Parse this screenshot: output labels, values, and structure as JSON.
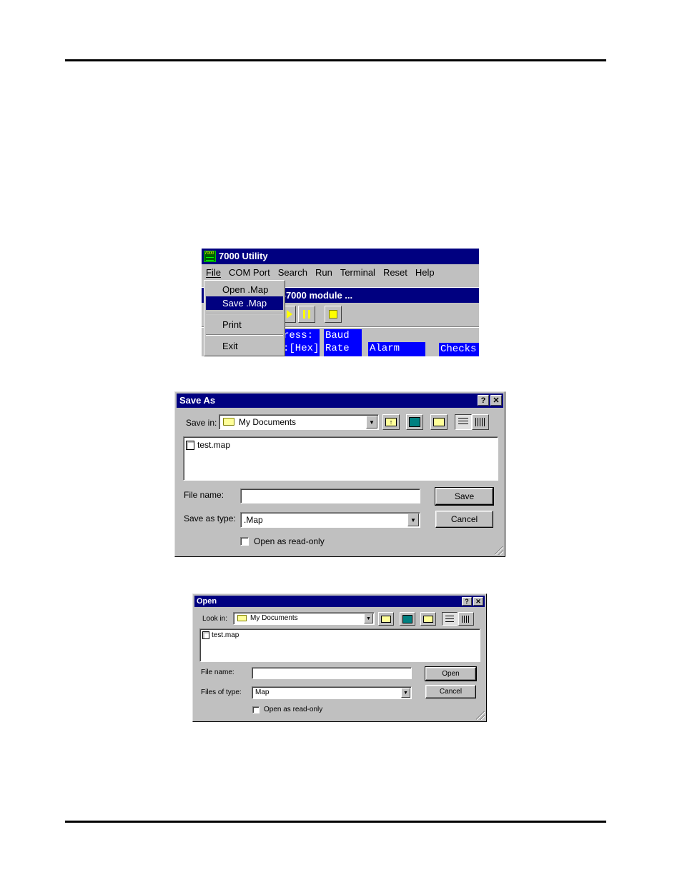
{
  "utility": {
    "title": "7000 Utility",
    "app_icon_text": "7000",
    "menu": [
      "File",
      "COM Port",
      "Search",
      "Run",
      "Terminal",
      "Reset",
      "Help"
    ],
    "file_menu": [
      "Open .Map",
      "Save .Map",
      "Print",
      "Exit"
    ],
    "selected_item": "Save .Map",
    "module_banner": "I-7000 module ...",
    "table_cells": [
      "ress:",
      "Baud",
      ":[Hex]",
      "Rate",
      "Alarm",
      "Checks"
    ],
    "colors": {
      "title": "#000080",
      "cells": "#0000ff",
      "play": "#ffff00"
    }
  },
  "saveas": {
    "title": "Save As",
    "help_label": "?",
    "close_label": "✕",
    "save_in_label": "Save in:",
    "location": "My Documents",
    "files": [
      "test.map"
    ],
    "file_name_label": "File name:",
    "file_name_value": "",
    "type_label": "Save as type:",
    "type_value": ".Map",
    "save_button": "Save",
    "cancel_button": "Cancel",
    "readonly_label": "Open as read-only"
  },
  "open": {
    "title": "Open",
    "help_label": "?",
    "close_label": "✕",
    "look_in_label": "Look in:",
    "location": "My Documents",
    "files": [
      "test.map"
    ],
    "file_name_label": "File name:",
    "file_name_value": "",
    "type_label": "Files of type:",
    "type_value": "Map",
    "open_button": "Open",
    "cancel_button": "Cancel",
    "readonly_label": "Open as read-only"
  }
}
